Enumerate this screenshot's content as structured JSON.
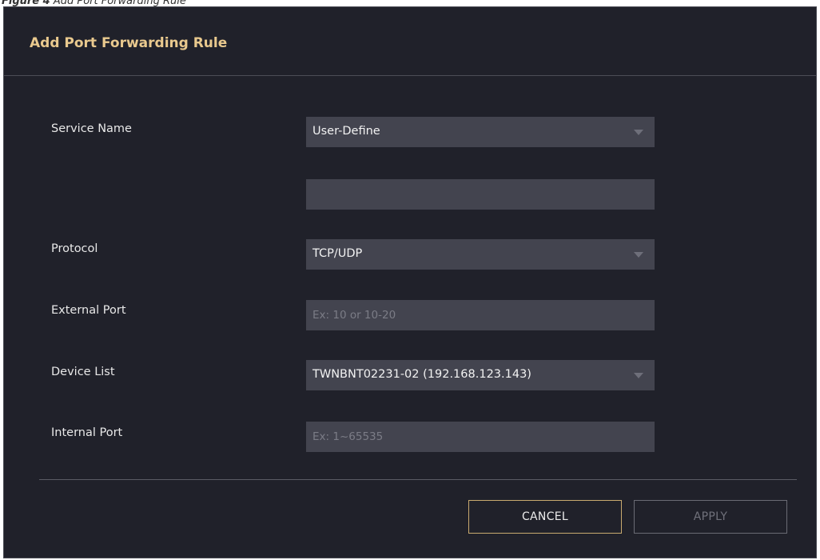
{
  "caption": {
    "prefix": "Figure 4",
    "text": "Add Port Forwarding Rule"
  },
  "dialog": {
    "title": "Add Port Forwarding Rule"
  },
  "form": {
    "service_name": {
      "label": "Service Name",
      "selected": "User-Define",
      "custom_value": ""
    },
    "protocol": {
      "label": "Protocol",
      "selected": "TCP/UDP"
    },
    "external_port": {
      "label": "External Port",
      "value": "",
      "placeholder": "Ex: 10 or 10-20"
    },
    "device_list": {
      "label": "Device List",
      "selected": "TWNBNT02231-02 (192.168.123.143)"
    },
    "internal_port": {
      "label": "Internal Port",
      "value": "",
      "placeholder": "Ex: 1~65535"
    }
  },
  "buttons": {
    "cancel_label": "CANCEL",
    "apply_label": "APPLY"
  },
  "colors": {
    "dialog_bg": "#20212a",
    "field_bg": "#43444f",
    "title_accent": "#e9c98e",
    "cancel_border": "#c9aa6f",
    "apply_disabled": "#70717b"
  }
}
